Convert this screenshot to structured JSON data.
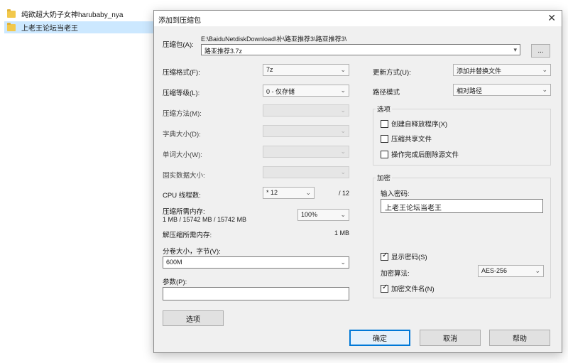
{
  "explorer": {
    "files": [
      {
        "name": "纯欲超大奶子女神harubaby_nya"
      },
      {
        "name": "上老王论坛当老王"
      }
    ]
  },
  "dialog": {
    "title": "添加到压缩包",
    "close_glyph": "✕",
    "archive_label": "压缩包(A):",
    "archive_path": "E:\\BaiduNetdiskDownload\\补\\路亚推荐3\\路亚推荐3\\",
    "archive_name": "路亚推荐3.7z",
    "browse_label": "...",
    "left": {
      "format_label": "压缩格式(F):",
      "format_value": "7z",
      "level_label": "压缩等级(L):",
      "level_value": "0 - 仅存储",
      "method_label": "压缩方法(M):",
      "dict_label": "字典大小(D):",
      "word_label": "单词大小(W):",
      "solid_label": "固实数据大小:",
      "cpu_label": "CPU 线程数:",
      "cpu_value": "* 12",
      "cpu_total": "/ 12",
      "mem_comp_label": "压缩所需内存:",
      "mem_comp_detail": "1 MB / 15742 MB / 15742 MB",
      "mem_percent": "100%",
      "mem_decomp_label": "解压缩所需内存:",
      "mem_decomp_value": "1 MB",
      "split_label": "分卷大小，字节(V):",
      "split_value": "600M",
      "params_label": "参数(P):",
      "params_value": "",
      "options_button": "选项"
    },
    "right": {
      "update_label": "更新方式(U):",
      "update_value": "添加并替换文件",
      "pathmode_label": "路径模式",
      "pathmode_value": "相对路径",
      "options_group": "选项",
      "opt_sfx": "创建自释放程序(X)",
      "opt_shared": "压缩共享文件",
      "opt_delete": "操作完成后删除源文件",
      "encrypt_group": "加密",
      "password_label": "输入密码:",
      "password_value": "上老王论坛当老王",
      "show_password": "显示密码(S)",
      "enc_method_label": "加密算法:",
      "enc_method_value": "AES-256",
      "encrypt_names": "加密文件名(N)"
    },
    "buttons": {
      "ok": "确定",
      "cancel": "取消",
      "help": "帮助"
    },
    "checks": {
      "sfx": false,
      "shared": false,
      "delete": false,
      "show_password": true,
      "encrypt_names": true
    }
  }
}
